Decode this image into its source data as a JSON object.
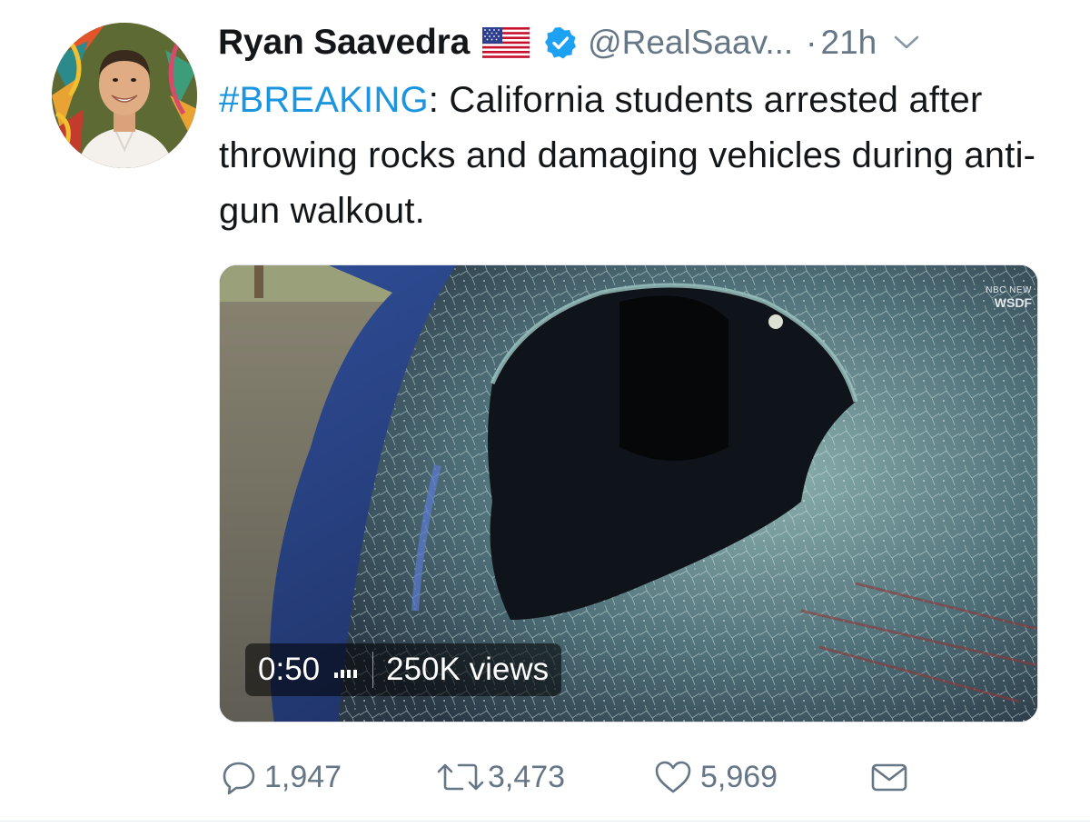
{
  "user": {
    "display_name": "Ryan Saavedra",
    "handle": "@RealSaav...",
    "separator": "·",
    "time_ago": "21h"
  },
  "icons": {
    "flag": "us-flag-emoji",
    "verified": "verified-badge-icon",
    "caret": "chevron-down-icon",
    "reply": "reply-icon",
    "retweet": "retweet-icon",
    "like": "heart-icon",
    "dm": "envelope-icon"
  },
  "tweet": {
    "hashtag": "#BREAKING",
    "text": ": California students arrested after throwing rocks and damaging vehicles during anti-gun walkout."
  },
  "media": {
    "watermark_network": "NBC NEW",
    "watermark_station": "WSDF",
    "duration": "0:50",
    "views": "250K views"
  },
  "actions": {
    "replies": "1,947",
    "retweets": "3,473",
    "likes": "5,969"
  },
  "colors": {
    "link": "#1b95e0",
    "verified": "#1da1f2",
    "muted": "#657786",
    "text": "#14171a"
  }
}
